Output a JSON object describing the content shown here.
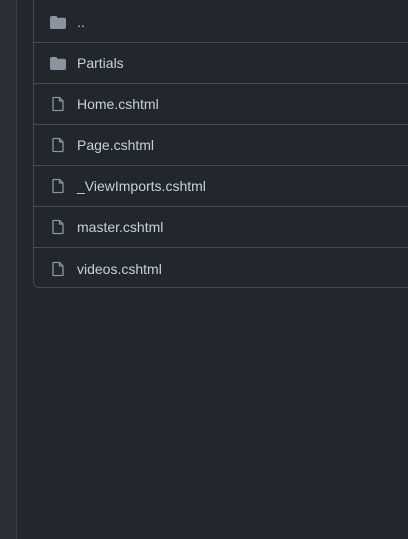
{
  "files": [
    {
      "name": "..",
      "icon": "folder-icon"
    },
    {
      "name": "Partials",
      "icon": "folder-icon"
    },
    {
      "name": "Home.cshtml",
      "icon": "file-icon"
    },
    {
      "name": "Page.cshtml",
      "icon": "file-icon"
    },
    {
      "name": "_ViewImports.cshtml",
      "icon": "file-icon"
    },
    {
      "name": "master.cshtml",
      "icon": "file-icon"
    },
    {
      "name": "videos.cshtml",
      "icon": "file-icon"
    }
  ],
  "colors": {
    "background": "#22272e",
    "border": "#444c56",
    "text": "#c9d1d9",
    "icon": "#8b949e"
  }
}
